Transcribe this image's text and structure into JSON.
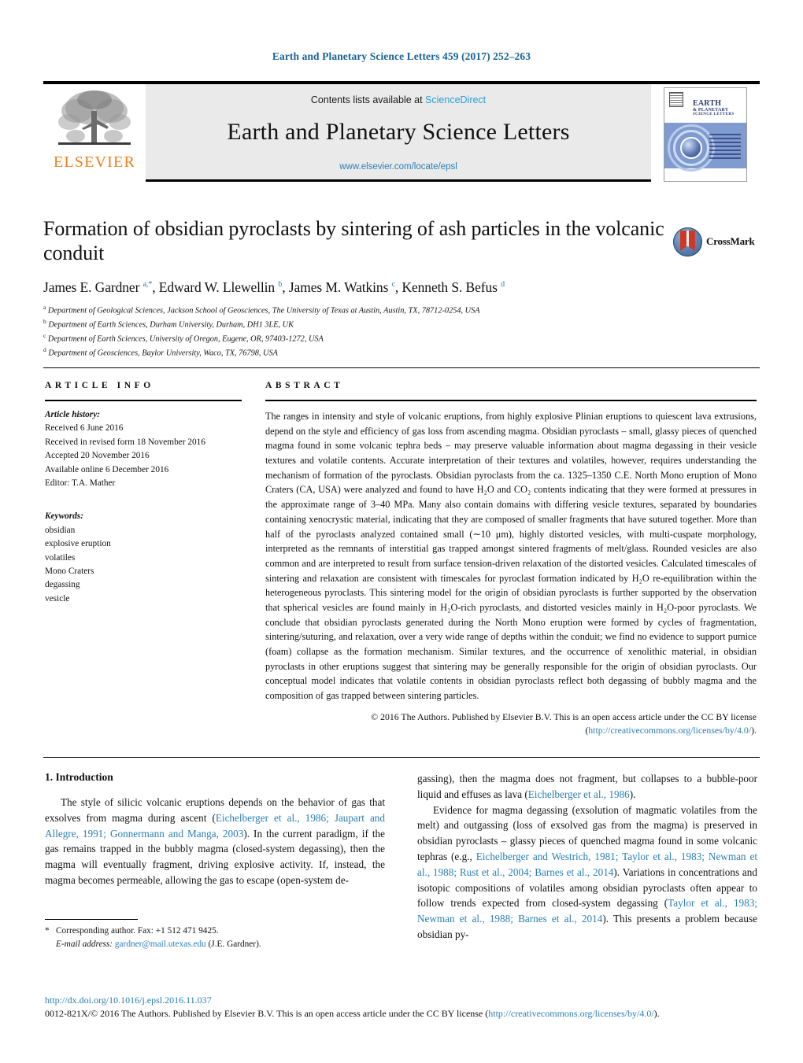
{
  "running_head": "Earth and Planetary Science Letters 459 (2017) 252–263",
  "masthead": {
    "contents_prefix": "Contents lists available at ",
    "sciencedirect": "ScienceDirect",
    "journal_title": "Earth and Planetary Science Letters",
    "journal_url": "www.elsevier.com/locate/epsl",
    "publisher_wordmark": "ELSEVIER",
    "cover": {
      "line1": "EARTH",
      "line2": "& PLANETARY",
      "line3": "SCIENCE LETTERS"
    }
  },
  "article": {
    "title": "Formation of obsidian pyroclasts by sintering of ash particles in the volcanic conduit",
    "authors_html": "James E. Gardner <sup>a,*</sup>, Edward W. Llewellin <sup>b</sup>, James M. Watkins <sup>c</sup>, Kenneth S. Befus <sup>d</sup>",
    "affiliations": [
      {
        "marker": "a",
        "text": "Department of Geological Sciences, Jackson School of Geosciences, The University of Texas at Austin, Austin, TX, 78712-0254, USA"
      },
      {
        "marker": "b",
        "text": "Department of Earth Sciences, Durham University, Durham, DH1 3LE, UK"
      },
      {
        "marker": "c",
        "text": "Department of Earth Sciences, University of Oregon, Eugene, OR, 97403-1272, USA"
      },
      {
        "marker": "d",
        "text": "Department of Geosciences, Baylor University, Waco, TX, 76798, USA"
      }
    ],
    "crossmark_label": "CrossMark"
  },
  "article_info": {
    "heading": "ARTICLE INFO",
    "history_label": "Article history:",
    "history": [
      "Received 6 June 2016",
      "Received in revised form 18 November 2016",
      "Accepted 20 November 2016",
      "Available online 6 December 2016",
      "Editor: T.A. Mather"
    ],
    "keywords_label": "Keywords:",
    "keywords": [
      "obsidian",
      "explosive eruption",
      "volatiles",
      "Mono Craters",
      "degassing",
      "vesicle"
    ]
  },
  "abstract": {
    "heading": "ABSTRACT",
    "text": "The ranges in intensity and style of volcanic eruptions, from highly explosive Plinian eruptions to quiescent lava extrusions, depend on the style and efficiency of gas loss from ascending magma. Obsidian pyroclasts – small, glassy pieces of quenched magma found in some volcanic tephra beds – may preserve valuable information about magma degassing in their vesicle textures and volatile contents. Accurate interpretation of their textures and volatiles, however, requires understanding the mechanism of formation of the pyroclasts. Obsidian pyroclasts from the ca. 1325–1350 C.E. North Mono eruption of Mono Craters (CA, USA) were analyzed and found to have H₂O and CO₂ contents indicating that they were formed at pressures in the approximate range of 3–40 MPa. Many also contain domains with differing vesicle textures, separated by boundaries containing xenocrystic material, indicating that they are composed of smaller fragments that have sutured together. More than half of the pyroclasts analyzed contained small (∼10 μm), highly distorted vesicles, with multi-cuspate morphology, interpreted as the remnants of interstitial gas trapped amongst sintered fragments of melt/glass. Rounded vesicles are also common and are interpreted to result from surface tension-driven relaxation of the distorted vesicles. Calculated timescales of sintering and relaxation are consistent with timescales for pyroclast formation indicated by H₂O re-equilibration within the heterogeneous pyroclasts. This sintering model for the origin of obsidian pyroclasts is further supported by the observation that spherical vesicles are found mainly in H₂O-rich pyroclasts, and distorted vesicles mainly in H₂O-poor pyroclasts. We conclude that obsidian pyroclasts generated during the North Mono eruption were formed by cycles of fragmentation, sintering/suturing, and relaxation, over a very wide range of depths within the conduit; we find no evidence to support pumice (foam) collapse as the formation mechanism. Similar textures, and the occurrence of xenolithic material, in obsidian pyroclasts in other eruptions suggest that sintering may be generally responsible for the origin of obsidian pyroclasts. Our conceptual model indicates that volatile contents in obsidian pyroclasts reflect both degassing of bubbly magma and the composition of gas trapped between sintering particles.",
    "copyright_text": "© 2016 The Authors. Published by Elsevier B.V. This is an open access article under the CC BY license",
    "license_url": "(http://creativecommons.org/licenses/by/4.0/).",
    "license_open": "(",
    "license_link": "http://creativecommons.org/licenses/by/4.0/",
    "license_close": ")."
  },
  "introduction": {
    "heading": "1. Introduction",
    "left_para_1_a": "The style of silicic volcanic eruptions depends on the behavior of gas that exsolves from magma during ascent (",
    "left_para_1_refs": "Eichelberger et al., 1986; Jaupart and Allegre, 1991; Gonnermann and Manga, 2003",
    "left_para_1_b": "). In the current paradigm, if the gas remains trapped in the bubbly magma (closed-system degassing), then the magma will eventually fragment, driving explosive activity. If, instead, the magma becomes permeable, allowing the gas to escape (open-system de-",
    "right_para_1_a": "gassing), then the magma does not fragment, but collapses to a bubble-poor liquid and effuses as lava (",
    "right_para_1_ref": "Eichelberger et al., 1986",
    "right_para_1_b": ").",
    "right_para_2_a": "Evidence for magma degassing (exsolution of magmatic volatiles from the melt) and outgassing (loss of exsolved gas from the magma) is preserved in obsidian pyroclasts – glassy pieces of quenched magma found in some volcanic tephras (e.g., ",
    "right_para_2_refs_1": "Eichelberger and Westrich, 1981; Taylor et al., 1983; Newman et al., 1988; Rust et al., 2004; Barnes et al., 2014",
    "right_para_2_b": "). Variations in concentrations and isotopic compositions of volatiles among obsidian pyroclasts often appear to follow trends expected from closed-system degassing (",
    "right_para_2_refs_2": "Taylor et al., 1983; Newman et al., 1988; Barnes et al., 2014",
    "right_para_2_c": "). This presents a problem because obsidian py-"
  },
  "footnote": {
    "star": "*",
    "corresponding": "Corresponding author. Fax: +1 512 471 9425.",
    "email_label": "E-mail address:",
    "email": "gardner@mail.utexas.edu",
    "email_owner": "(J.E. Gardner)."
  },
  "footer": {
    "doi": "http://dx.doi.org/10.1016/j.epsl.2016.11.037",
    "issn_prefix": "0012-821X/© 2016 The Authors. Published by Elsevier B.V. This is an open access article under the CC BY license (",
    "issn_link": "http://creativecommons.org/licenses/by/4.0/",
    "issn_suffix": ")."
  },
  "colors": {
    "link": "#2a7fb5",
    "elsevier_orange": "#ef7d1a",
    "masthead_bg": "#eaeaea"
  }
}
